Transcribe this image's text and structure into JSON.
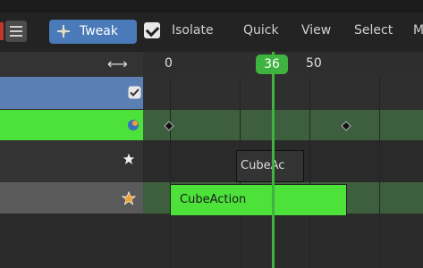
{
  "header": {
    "tweak_label": "Tweak",
    "isolate_checked": true,
    "menu": [
      "Isolate",
      "Quick",
      "View",
      "Select",
      "M"
    ]
  },
  "ruler": {
    "ticks": [
      "0",
      "50"
    ],
    "current_frame": "36",
    "swap_icon": "⟷"
  },
  "channels": [
    {
      "name": "channel-checkbox-row",
      "icon": "checkbox-icon",
      "color": "#5b7fb3"
    },
    {
      "name": "channel-object-row",
      "icon": "object-icon",
      "color": "#4ce23a"
    },
    {
      "name": "channel-star-row",
      "icon": "star-icon",
      "color": "#333333"
    },
    {
      "name": "channel-star-active-row",
      "icon": "star-orange-icon",
      "color": "#5a5a5a"
    }
  ],
  "strips": {
    "gray_label": "CubeAc",
    "green_label": "CubeAction"
  },
  "colors": {
    "accent_blue": "#4a7ab8",
    "accent_green": "#3fb33f",
    "strip_green": "#4ce23a"
  }
}
